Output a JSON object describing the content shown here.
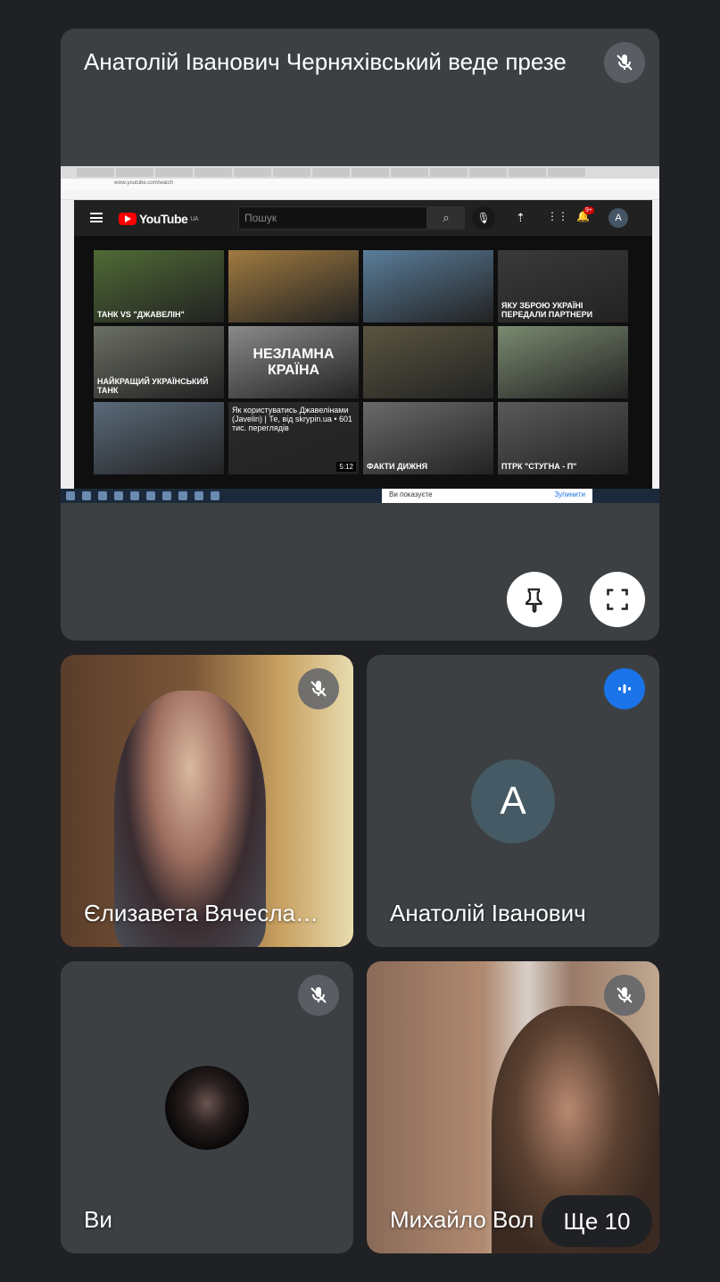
{
  "presenter_tile": {
    "title": "Анатолій Іванович Черняхівський веде презе",
    "shared_screen": {
      "address": "www.youtube.com/watch",
      "youtube_logo": "YouTube",
      "region": "UA",
      "search_placeholder": "Пошук",
      "notifications_badge": "9+",
      "account_initial": "A",
      "thumbnails": [
        {
          "text": "ТАНК VS \"ДЖАВЕЛІН\"",
          "color": "#4f6a35"
        },
        {
          "text": "",
          "color": "#a07a40"
        },
        {
          "text": "",
          "color": "#5a7d9a"
        },
        {
          "text": "ЯКУ ЗБРОЮ УКРАЇНІ ПЕРЕДАЛИ ПАРТНЕРИ",
          "color": "#3a3a3a"
        },
        {
          "text": "НАЙКРАЩИЙ УКРАЇНСЬКИЙ ТАНК",
          "color": "#6b6f64"
        },
        {
          "text": "НЕЗЛАМНА КРАЇНА",
          "color": "#8a8a8a"
        },
        {
          "text": "",
          "color": "#5a5540"
        },
        {
          "text": "",
          "color": "#7a8a70"
        },
        {
          "text": "",
          "color": "#5a6a7a"
        },
        {
          "text": "Як користуватись Джавелінами (Javelin) | Те, від skrypin.ua • 601 тис. переглядів",
          "color": "#2a2a2a",
          "duration": "5:12"
        },
        {
          "text": "ФАКТИ ДИЖНЯ",
          "color": "#6a6a6a"
        },
        {
          "text": "ПТРК \"СТУГНА - П\"",
          "color": "#5a5a5a"
        }
      ],
      "share_notice": "Ви показуєте",
      "stop_label": "Зупинити"
    },
    "pin_icon": "pin-icon",
    "fullscreen_icon": "fullscreen-icon"
  },
  "participants": [
    {
      "name": "Єлизавета Вячесла…",
      "muted": true
    },
    {
      "name": "Анатолій Іванович",
      "initial": "A",
      "speaking": true,
      "avatar_color": "#455a64"
    },
    {
      "name": "Ви",
      "muted": true
    },
    {
      "name": "Михайло Вол",
      "muted": true
    }
  ],
  "more_participants": "Ще 10",
  "colors": {
    "background": "#202124",
    "tile": "#3c4043",
    "speaking": "#1a73e8"
  }
}
